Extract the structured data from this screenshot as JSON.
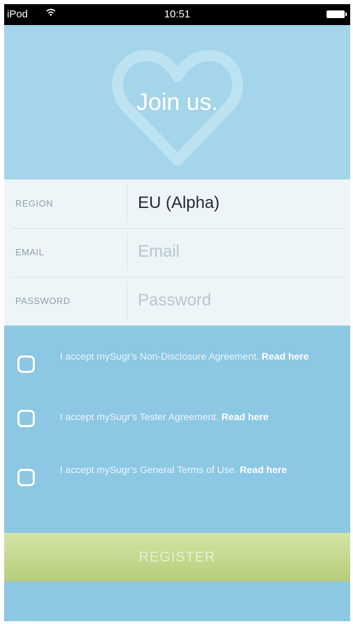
{
  "status_bar": {
    "carrier": "iPod",
    "wifi_icon": "wifi-icon",
    "time": "10:51",
    "battery_icon": "battery-icon"
  },
  "header": {
    "title": "Join us.",
    "heart_icon": "heart-icon"
  },
  "form": {
    "region": {
      "label": "REGION",
      "value": "EU (Alpha)"
    },
    "email": {
      "label": "EMAIL",
      "value": "",
      "placeholder": "Email"
    },
    "password": {
      "label": "PASSWORD",
      "value": "",
      "placeholder": "Password"
    }
  },
  "agreements": [
    {
      "text": "I accept mySugr's Non-Disclosure Agreement.",
      "link": "Read here",
      "checked": false
    },
    {
      "text": "I accept mySugr's Tester Agreement.",
      "link": "Read here",
      "checked": false
    },
    {
      "text": "I accept mySugr's General Terms of Use.",
      "link": "Read here",
      "checked": false
    }
  ],
  "register_button": {
    "label": "REGISTER"
  },
  "colors": {
    "background": "#8cc7e3",
    "header": "#a5d5ea",
    "form": "#eef5f9",
    "register": "#c6dc8f"
  }
}
